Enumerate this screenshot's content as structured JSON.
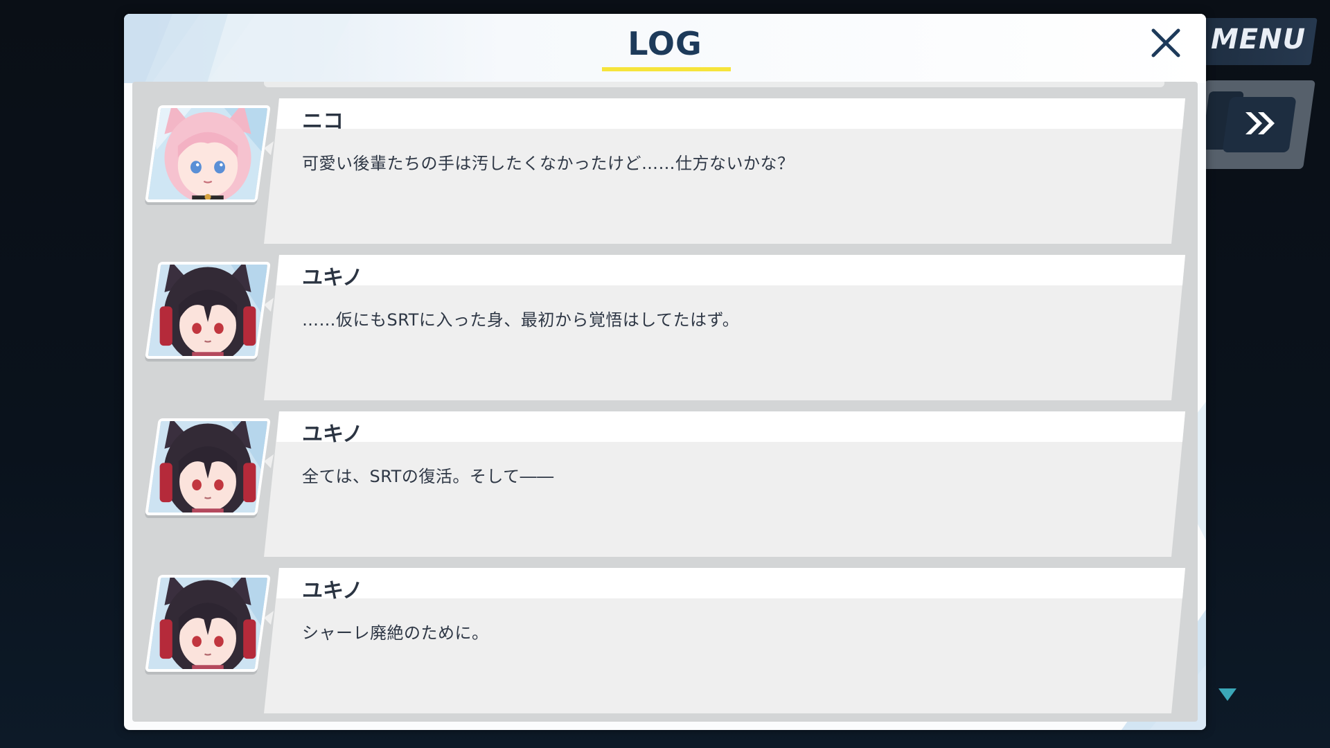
{
  "dialog": {
    "title": "LOG",
    "close_icon": "close-icon"
  },
  "side_ui": {
    "menu_label": "MENU",
    "fast_forward_icon": "fast-forward-icon",
    "scroll_icon": "triangle-down-icon"
  },
  "colors": {
    "title": "#1d3a5a",
    "underline": "#f6e43b",
    "list_bg": "#d3d5d6",
    "bubble_name": "#ffffff",
    "bubble_body": "#efefef"
  },
  "entries": [
    {
      "speaker": "ニコ",
      "text": "可愛い後輩たちの手は汚したくなかったけど……仕方ないかな？",
      "portrait": "niko-portrait"
    },
    {
      "speaker": "ユキノ",
      "text": "……仮にもSRTに入った身、最初から覚悟はしてたはず。",
      "portrait": "yukino-portrait"
    },
    {
      "speaker": "ユキノ",
      "text": "全ては、SRTの復活。そして――",
      "portrait": "yukino-portrait"
    },
    {
      "speaker": "ユキノ",
      "text": "シャーレ廃絶のために。",
      "portrait": "yukino-portrait"
    }
  ]
}
